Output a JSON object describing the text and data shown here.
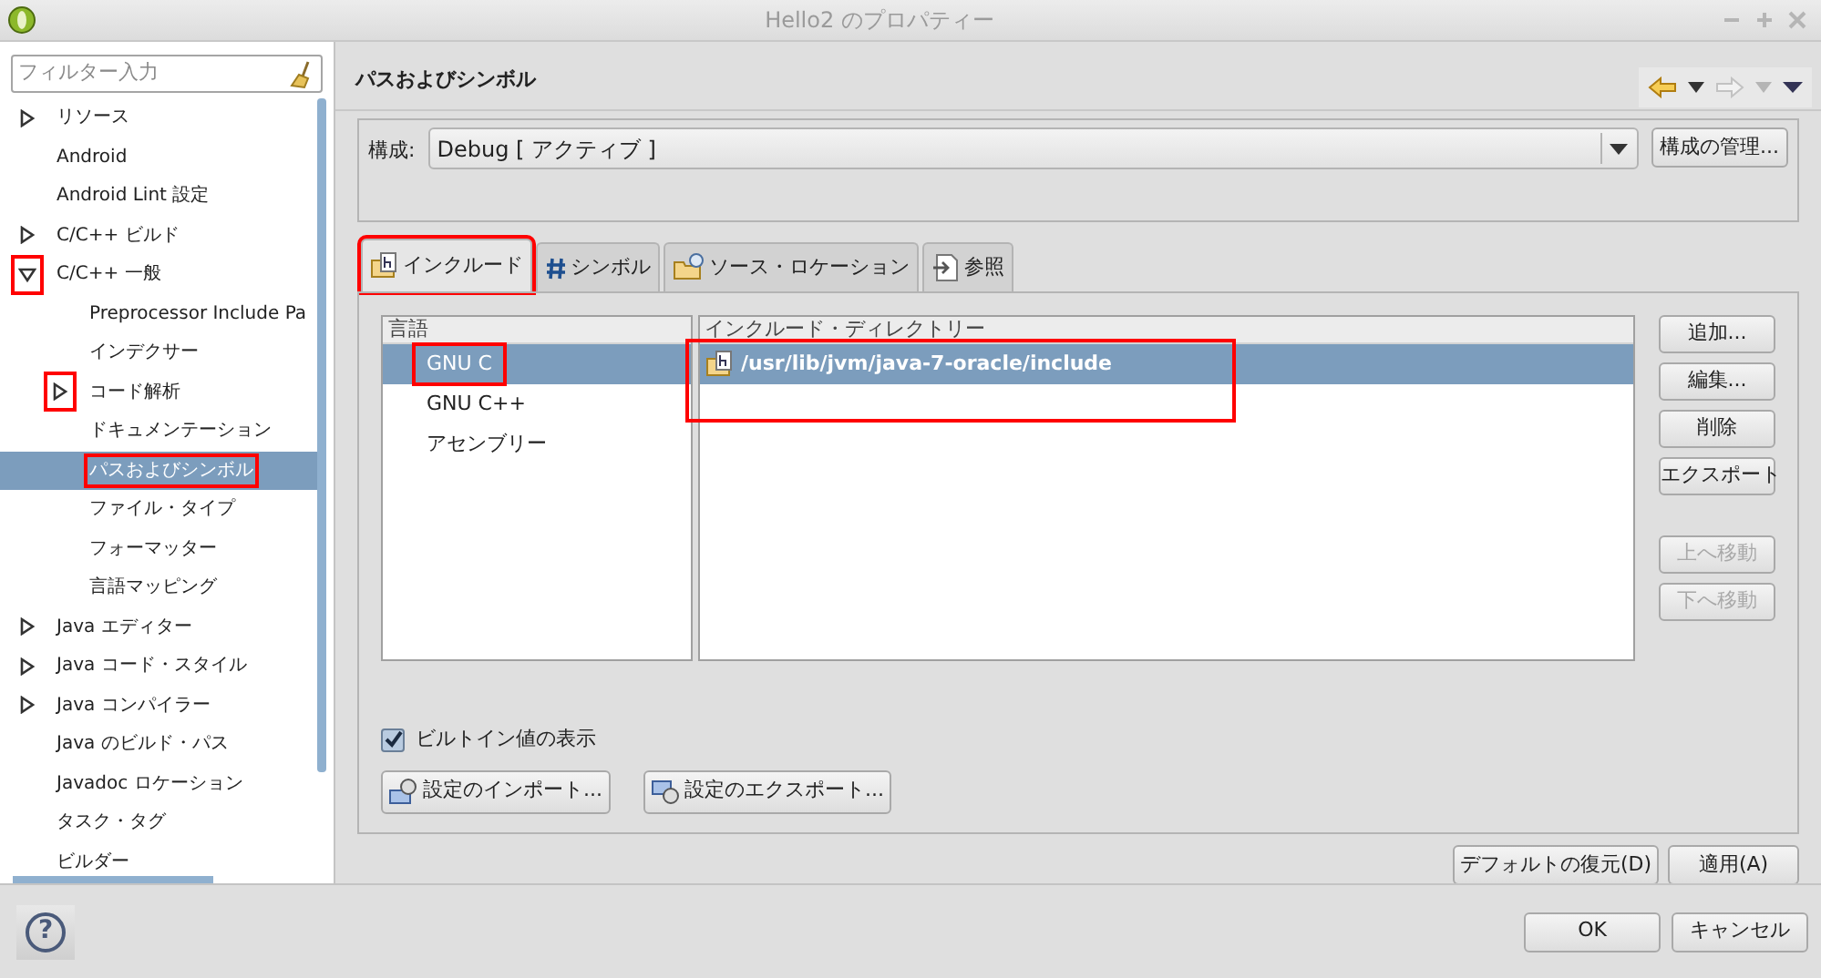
{
  "window": {
    "title": "Hello2 のプロパティー"
  },
  "filter": {
    "placeholder": "フィルター入力"
  },
  "tree": [
    {
      "label": "リソース",
      "expanded": false,
      "selected": false,
      "marked": false
    },
    {
      "label": "Android",
      "selected": false
    },
    {
      "label": "Android Lint 設定",
      "selected": false
    },
    {
      "label": "C/C++ ビルド",
      "expanded": false,
      "selected": false,
      "marked": false
    },
    {
      "label": "C/C++ 一般",
      "expanded": true,
      "selected": false,
      "marked": true,
      "children": [
        {
          "label": "Preprocessor Include Pa",
          "selected": false
        },
        {
          "label": "インデクサー",
          "selected": false
        },
        {
          "label": "コード解析",
          "expanded": false,
          "selected": false,
          "marked": true
        },
        {
          "label": "ドキュメンテーション",
          "selected": false
        },
        {
          "label": "パスおよびシンボル",
          "selected": true,
          "marked": true
        },
        {
          "label": "ファイル・タイプ",
          "selected": false
        },
        {
          "label": "フォーマッター",
          "selected": false
        },
        {
          "label": "言語マッピング",
          "selected": false
        }
      ]
    },
    {
      "label": "Java エディター",
      "expanded": false,
      "selected": false,
      "marked": false
    },
    {
      "label": "Java コード・スタイル",
      "expanded": false,
      "selected": false,
      "marked": false
    },
    {
      "label": "Java コンパイラー",
      "expanded": false,
      "selected": false,
      "marked": false
    },
    {
      "label": "Java のビルド・パス",
      "selected": false
    },
    {
      "label": "Javadoc ロケーション",
      "selected": false
    },
    {
      "label": "タスク・タグ",
      "selected": false
    },
    {
      "label": "ビルダー",
      "selected": false
    }
  ],
  "page_title": "パスおよびシンボル",
  "config": {
    "label": "構成:",
    "value": "Debug  [ アクティブ ]",
    "manage_button": "構成の管理..."
  },
  "tabs": [
    {
      "label": "インクルード",
      "kind": "include",
      "selected": true,
      "marked": true
    },
    {
      "label": "シンボル",
      "kind": "symbol",
      "selected": false,
      "marked": false
    },
    {
      "label": "ソース・ロケーション",
      "kind": "source",
      "selected": false,
      "marked": false
    },
    {
      "label": "参照",
      "kind": "reference",
      "selected": false,
      "marked": false
    }
  ],
  "languages": {
    "header": "言語",
    "items": [
      {
        "label": "GNU C",
        "selected": true,
        "marked": true
      },
      {
        "label": "GNU C++",
        "selected": false,
        "marked": false
      },
      {
        "label": "アセンブリー",
        "selected": false,
        "marked": false
      }
    ]
  },
  "include_dirs": {
    "header": "インクルード・ディレクトリー",
    "items": [
      {
        "label": "/usr/lib/jvm/java-7-oracle/include",
        "selected": true,
        "marked": true
      }
    ]
  },
  "side_buttons": [
    {
      "label": "追加...",
      "disabled": false
    },
    {
      "label": "編集...",
      "disabled": false
    },
    {
      "label": "削除",
      "disabled": false
    },
    {
      "label": "エクスポート",
      "disabled": false
    },
    {
      "label": "上へ移動",
      "disabled": true
    },
    {
      "label": "下へ移動",
      "disabled": true
    }
  ],
  "show_builtin": {
    "label": "ビルトイン値の表示",
    "checked": true
  },
  "import_button": "設定のインポート...",
  "export_button": "設定のエクスポート...",
  "restore_button": "デフォルトの復元(D)",
  "apply_button": "適用(A)",
  "ok_button": "OK",
  "cancel_button": "キャンセル",
  "help_button": "?"
}
